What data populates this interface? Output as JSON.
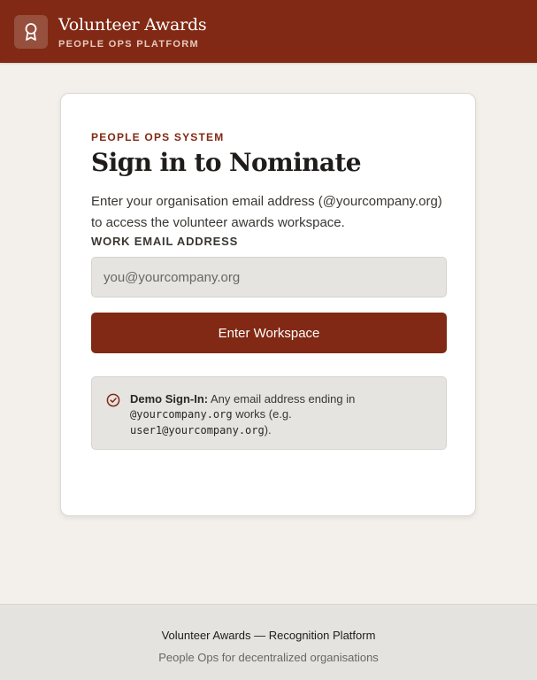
{
  "header": {
    "title": "Volunteer Awards",
    "subtitle": "PEOPLE OPS PLATFORM",
    "logo_icon": "award-ribbon-icon"
  },
  "signin": {
    "eyebrow": "PEOPLE OPS SYSTEM",
    "heading": "Sign in to Nominate",
    "intro": "Enter your organisation email address (@yourcompany.org) to access the volunteer awards workspace.",
    "email_label": "WORK EMAIL ADDRESS",
    "email_value": "",
    "email_placeholder": "you@yourcompany.org",
    "submit_label": "Enter Workspace"
  },
  "notice": {
    "icon": "check-circle-icon",
    "title": "Demo Sign-In:",
    "text_1": " Any email address ending in ",
    "domain_code": "@yourcompany.org",
    "text_2": " works (e.g. ",
    "example_code": "user1@yourcompany.org",
    "text_3": ")."
  },
  "footer": {
    "title": "Volunteer Awards — Recognition Platform",
    "subtitle": "People Ops for decentralized organisations"
  },
  "colors": {
    "brand": "#812914",
    "background": "#f3f0ec",
    "card": "#ffffff",
    "field": "#e6e4e1"
  }
}
